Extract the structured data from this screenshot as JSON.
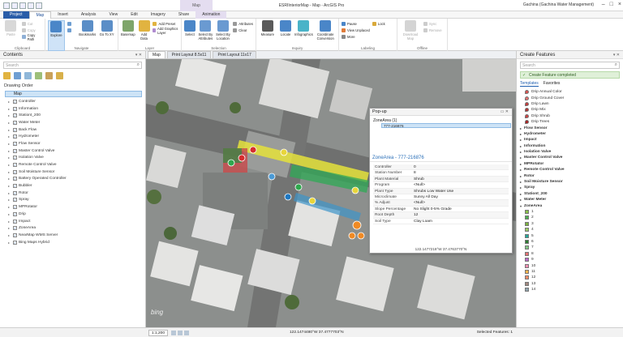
{
  "window": {
    "title": "ESRIInteriorMap - Map - ArcGIS Pro",
    "context_group": "Map",
    "user": "Gachina (Gachina Water Management)"
  },
  "tabs": [
    "Project",
    "Map",
    "Insert",
    "Analysis",
    "View",
    "Edit",
    "Imagery",
    "Share",
    "Animation"
  ],
  "ribbon": {
    "clipboard": {
      "paste": "Paste",
      "cut": "Cut",
      "copy": "Copy",
      "copy_path": "Copy Path",
      "label": "Clipboard"
    },
    "navigate": {
      "explore": "Explore",
      "bookmarks": "Bookmarks",
      "goto": "Go To XY",
      "label": "Navigate"
    },
    "layer": {
      "basemap": "Basemap",
      "add_data": "Add Data",
      "add_preset": "Add Preset",
      "add_graphics": "Add Graphics Layer",
      "label": "Layer"
    },
    "selection": {
      "select": "Select",
      "by_attributes": "Select By Attributes",
      "by_location": "Select By Location",
      "attributes": "Attributes",
      "clear": "Clear",
      "label": "Selection"
    },
    "inquiry": {
      "measure": "Measure",
      "locate": "Locate",
      "infographics": "Infographics",
      "coordinate": "Coordinate Conversion",
      "label": "Inquiry"
    },
    "labeling": {
      "pause": "Pause",
      "view_unplaced": "View Unplaced",
      "more": "More",
      "lock": "Lock",
      "label": "Labeling"
    },
    "offline": {
      "download": "Download Map",
      "sync": "Sync",
      "remove": "Remove",
      "label": "Offline"
    }
  },
  "contents": {
    "title": "Contents",
    "search_placeholder": "Search",
    "section": "Drawing Order",
    "map_label": "Map",
    "layers": [
      "Controller",
      "Information",
      "Stationt_200",
      "Water Meter",
      "Back Flow",
      "Hydrometer",
      "Flow Sensor",
      "Master Control Valve",
      "Isolation Valve",
      "Remote Control Valve",
      "Soil Moisture Sensor",
      "Battery Operated Controller",
      "Bubbler",
      "Rotor",
      "Spray",
      "MPRotator",
      "Drip",
      "Impact",
      "ZoneArea",
      "NearMap WMS Server",
      "Bing Maps Hybrid"
    ]
  },
  "views": {
    "map": "Map",
    "layout1": "Print Layout 8.5x11",
    "layout2": "Print Layout 11x17"
  },
  "map": {
    "watermark": "bing"
  },
  "popup": {
    "title": "Pop-up",
    "tree_group": "ZoneArea  (1)",
    "tree_item": "777-216876",
    "feature_title": "ZoneArea - 777-216876",
    "rows": [
      {
        "k": "Controller",
        "v": "0"
      },
      {
        "k": "Station Number",
        "v": "8"
      },
      {
        "k": "Plant Material",
        "v": "Shrub"
      },
      {
        "k": "Program",
        "v": "<Null>"
      },
      {
        "k": "Plant Type",
        "v": "Shrubs Low Water Use"
      },
      {
        "k": "Microclimate",
        "v": "Sunny All Day"
      },
      {
        "k": "% Adjust",
        "v": "<Null>"
      },
      {
        "k": "Slope Percentage",
        "v": "No Slight 0-5% Grade"
      },
      {
        "k": "Root Depth",
        "v": "12"
      },
      {
        "k": "Soil Type",
        "v": "Clay Loam"
      }
    ],
    "coord": "122.1477218°W 37.4763770°N"
  },
  "create": {
    "title": "Create Features",
    "search_placeholder": "Search",
    "notice": "Create Feature completed",
    "tab_templates": "Templates",
    "tab_favorites": "Favorites",
    "drip_items": [
      "Drip Annual Color",
      "Drip Ground Cover",
      "Drip Lawn",
      "Drip Mix",
      "Drip Shrub",
      "Drip Trees"
    ],
    "groups": [
      "Flow Sensor",
      "Hydrometer",
      "Impact",
      "Information",
      "Isolation Valve",
      "Master Control Valve",
      "MPRotator",
      "Remote Control Valve",
      "Rotor",
      "Soil Moisture Sensor",
      "Spray",
      "Stationt_200",
      "Water Meter",
      "ZoneArea"
    ],
    "zones": [
      "1",
      "2",
      "3",
      "4",
      "5",
      "6",
      "7",
      "8",
      "9",
      "10",
      "11",
      "12",
      "13",
      "14"
    ]
  },
  "status": {
    "scale": "1:1,200",
    "coords": "122.1474480°W 37.4777703°N",
    "selected": "Selected Features: 1"
  },
  "colors": {
    "accent": "#2a5da8",
    "drip_colors": [
      "#d9534f",
      "#e07070",
      "#c43c3c",
      "#b33333",
      "#cc4444",
      "#aa2222"
    ],
    "zone_colors": [
      "#8bc34a",
      "#4caf50",
      "#7cb342",
      "#9ccc65",
      "#26a69a",
      "#2e7d32",
      "#81c784",
      "#e57373",
      "#ba68c8",
      "#f48fb1",
      "#ffb74d",
      "#ff8a65",
      "#a1887f",
      "#90a4ae"
    ]
  }
}
